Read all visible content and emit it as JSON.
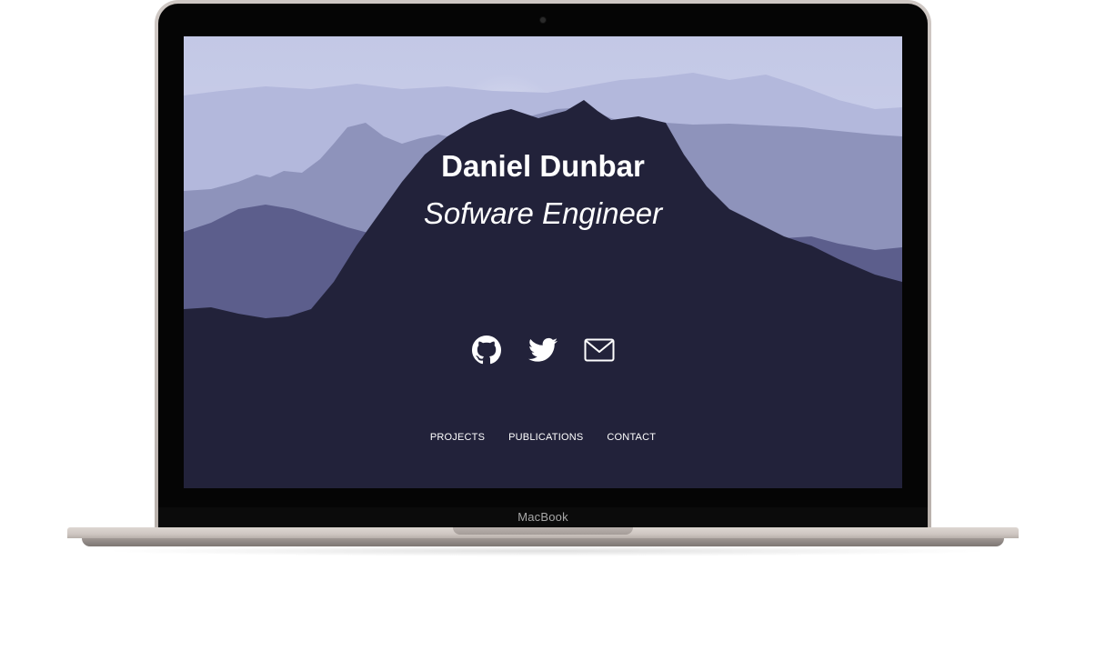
{
  "device": {
    "brand_label": "MacBook"
  },
  "hero": {
    "name": "Daniel Dunbar",
    "role": "Sofware Engineer"
  },
  "social": [
    {
      "icon": "github-icon"
    },
    {
      "icon": "twitter-icon"
    },
    {
      "icon": "email-icon"
    }
  ],
  "nav": {
    "items": [
      {
        "label": "PROJECTS"
      },
      {
        "label": "PUBLICATIONS"
      },
      {
        "label": "CONTACT"
      }
    ]
  },
  "colors": {
    "sky": "#c9cde8",
    "foreground_mountain": "#22223a",
    "text": "#ffffff"
  }
}
